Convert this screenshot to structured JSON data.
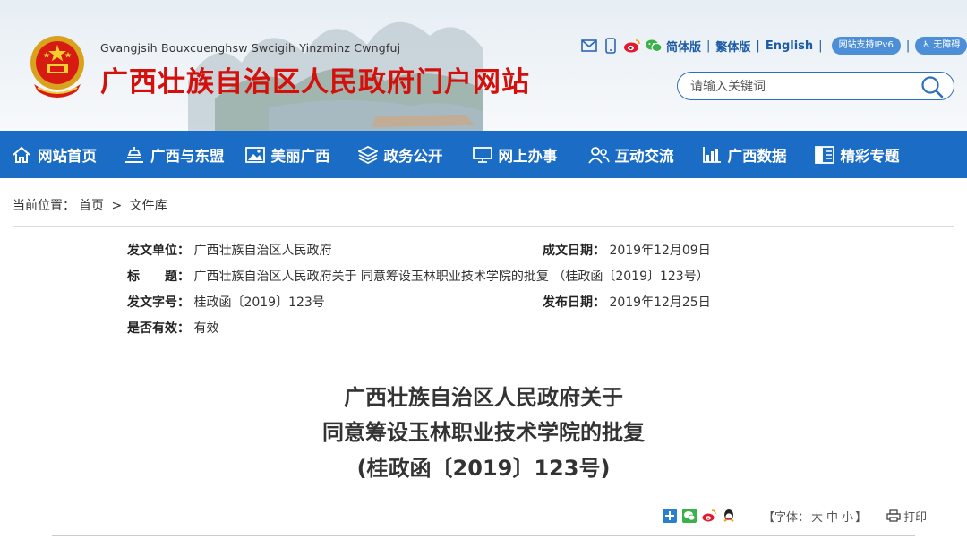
{
  "header": {
    "subtitle": "Gvangjsih Bouxcuenghsw Swcigih Yinzminz Cwngfuj",
    "title": "广西壮族自治区人民政府门户网站",
    "links": {
      "simplified": "简体版",
      "traditional": "繁体版",
      "english": "English",
      "ipv6": "网站支持IPv6",
      "accessible": "无障碍"
    },
    "icons": [
      "mail-icon",
      "mobile-icon",
      "weibo-icon",
      "wechat-icon"
    ],
    "search": {
      "placeholder": "请输入关键词"
    }
  },
  "nav": {
    "items": [
      {
        "label": "网站首页",
        "icon": "home-icon"
      },
      {
        "label": "广西与东盟",
        "icon": "landmark-icon"
      },
      {
        "label": "美丽广西",
        "icon": "picture-icon"
      },
      {
        "label": "政务公开",
        "icon": "layers-icon"
      },
      {
        "label": "网上办事",
        "icon": "monitor-icon"
      },
      {
        "label": "互动交流",
        "icon": "users-icon"
      },
      {
        "label": "广西数据",
        "icon": "bar-chart-icon"
      },
      {
        "label": "精彩专题",
        "icon": "panel-icon"
      }
    ]
  },
  "breadcrumb": {
    "prefix": "当前位置：",
    "home": "首页",
    "sep": ">",
    "current": "文件库"
  },
  "info": {
    "issuer_key": "发文单位：",
    "issuer": "广西壮族自治区人民政府",
    "date_key": "成文日期：",
    "date": "2019年12月09日",
    "title_key": "标　　题：",
    "title": "广西壮族自治区人民政府关于 同意筹设玉林职业技术学院的批复 （桂政函〔2019〕123号）",
    "docno_key": "发文字号：",
    "docno": "桂政函〔2019〕123号",
    "publish_key": "发布日期：",
    "publish": "2019年12月25日",
    "valid_key": "是否有效：",
    "valid": "有效"
  },
  "document": {
    "title_line1": "广西壮族自治区人民政府关于",
    "title_line2": "同意筹设玉林职业技术学院的批复",
    "title_line3": "(桂政函〔2019〕123号)"
  },
  "tools": {
    "share_icons": [
      "share-plus-icon",
      "wechat-share-icon",
      "weibo-share-icon",
      "qq-share-icon"
    ],
    "font_prefix": "【字体：",
    "font_large": "大",
    "font_medium": "中",
    "font_small": "小",
    "font_suffix": "】",
    "print": "打印"
  },
  "colors": {
    "title_red": "#d4100d",
    "nav_blue": "#1a6cc4",
    "link_blue": "#1c5ba6"
  }
}
